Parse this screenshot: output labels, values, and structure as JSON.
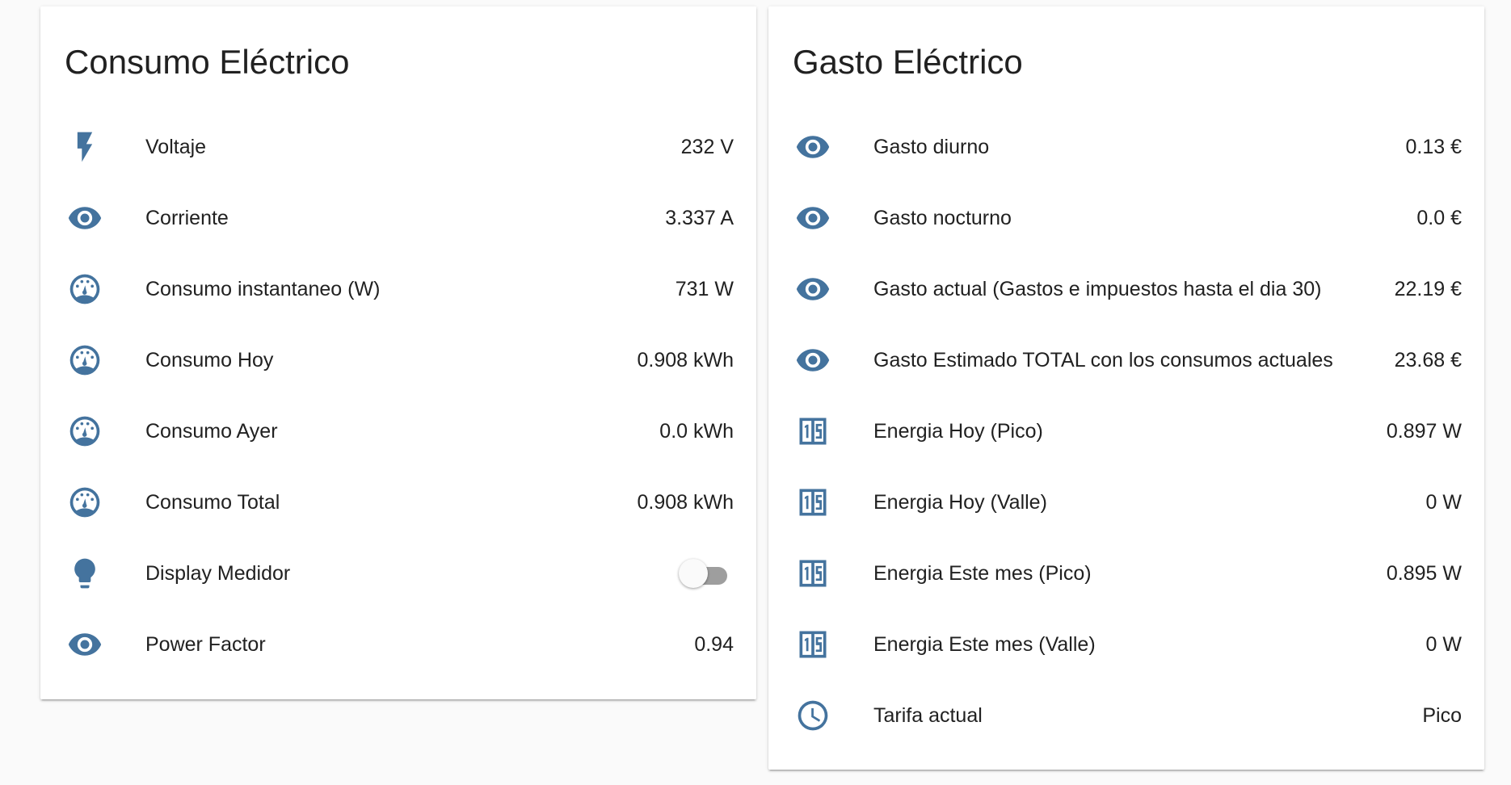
{
  "colors": {
    "icon": "#44739e",
    "toggle_track": "#9e9e9e"
  },
  "consumo": {
    "title": "Consumo Eléctrico",
    "rows": [
      {
        "icon": "flash-icon",
        "label": "Voltaje",
        "value": "232 V"
      },
      {
        "icon": "eye-icon",
        "label": "Corriente",
        "value": "3.337 A"
      },
      {
        "icon": "gauge-icon",
        "label": "Consumo instantaneo (W)",
        "value": "731 W"
      },
      {
        "icon": "gauge-icon",
        "label": "Consumo Hoy",
        "value": "0.908 kWh"
      },
      {
        "icon": "gauge-icon",
        "label": "Consumo Ayer",
        "value": "0.0 kWh"
      },
      {
        "icon": "gauge-icon",
        "label": "Consumo Total",
        "value": "0.908 kWh"
      },
      {
        "icon": "lightbulb-icon",
        "label": "Display Medidor",
        "toggle": false
      },
      {
        "icon": "eye-icon",
        "label": "Power Factor",
        "value": "0.94"
      }
    ]
  },
  "gasto": {
    "title": "Gasto Eléctrico",
    "rows": [
      {
        "icon": "eye-icon",
        "label": "Gasto diurno",
        "value": "0.13 €"
      },
      {
        "icon": "eye-icon",
        "label": "Gasto nocturno",
        "value": "0.0 €"
      },
      {
        "icon": "eye-icon",
        "label": "Gasto actual (Gastos e impuestos hasta el dia 30)",
        "value": "22.19 €"
      },
      {
        "icon": "eye-icon",
        "label": "Gasto Estimado TOTAL con los consumos actuales",
        "value": "23.68 €"
      },
      {
        "icon": "numeric-icon",
        "label": "Energia Hoy (Pico)",
        "value": "0.897 W"
      },
      {
        "icon": "numeric-icon",
        "label": "Energia Hoy (Valle)",
        "value": "0 W"
      },
      {
        "icon": "numeric-icon",
        "label": "Energia Este mes (Pico)",
        "value": "0.895 W"
      },
      {
        "icon": "numeric-icon",
        "label": "Energia Este mes (Valle)",
        "value": "0 W"
      },
      {
        "icon": "clock-icon",
        "label": "Tarifa actual",
        "value": "Pico"
      }
    ]
  }
}
